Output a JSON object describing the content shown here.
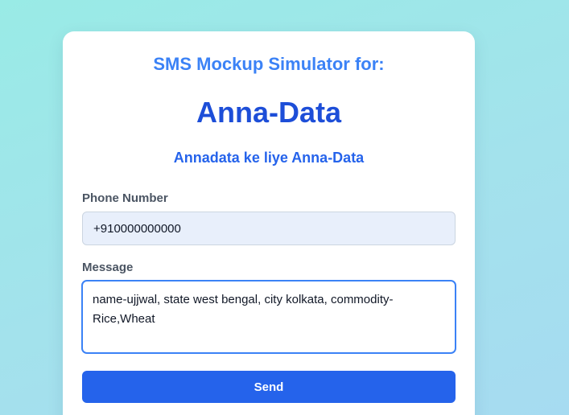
{
  "app": {
    "subtitle": "SMS Mockup Simulator for:",
    "title": "Anna-Data",
    "tagline": "Annadata ke liye Anna-Data"
  },
  "form": {
    "phone": {
      "label": "Phone Number",
      "value": "+910000000000"
    },
    "message": {
      "label": "Message",
      "value": "name-ujjwal, state west bengal, city kolkata, commodity-Rice,Wheat"
    },
    "send_label": "Send"
  },
  "colors": {
    "accent": "#2563eb",
    "title": "#1d4ed8",
    "subtitle": "#3b82f6",
    "input_bg": "#e8effb",
    "background": "#a3e2ec"
  }
}
